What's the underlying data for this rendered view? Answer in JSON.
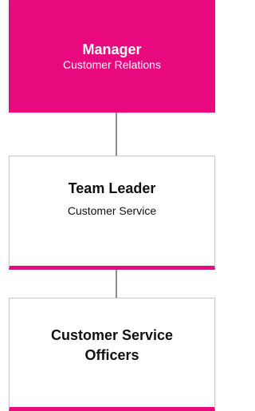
{
  "nodes": {
    "manager": {
      "title": "Manager",
      "subtitle": "Customer Relations"
    },
    "team_leader": {
      "title": "Team Leader",
      "subtitle": "Customer Service"
    },
    "officers": {
      "title": "Customer Service Officers"
    }
  },
  "colors": {
    "accent": "#e8097f",
    "connector": "#8e8e8e",
    "border": "#c9c9c9"
  }
}
